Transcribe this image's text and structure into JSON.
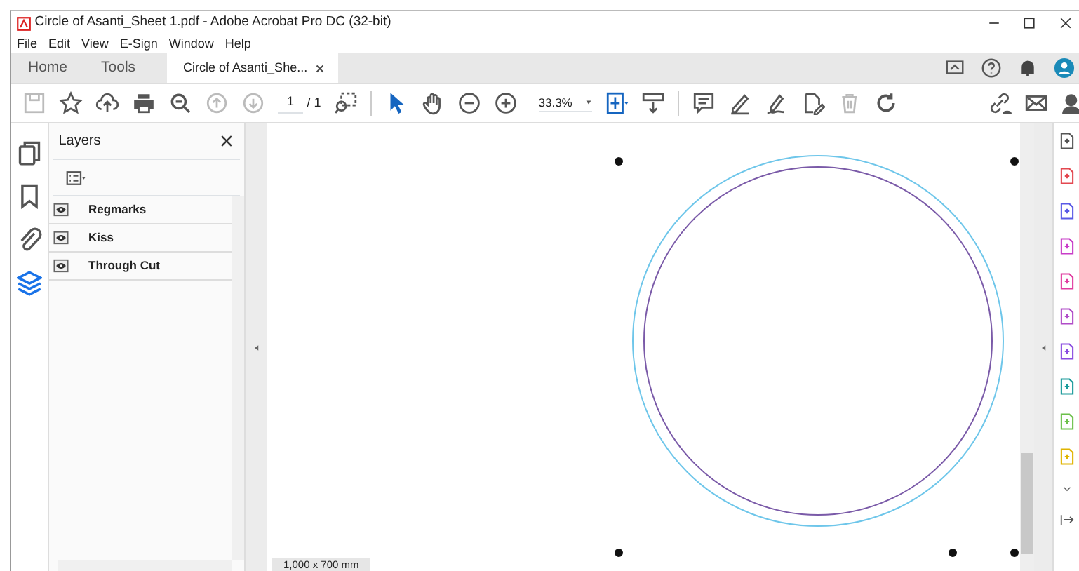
{
  "window": {
    "title": "Circle of Asanti_Sheet 1.pdf - Adobe Acrobat Pro DC (32-bit)"
  },
  "menu": [
    "File",
    "Edit",
    "View",
    "E-Sign",
    "Window",
    "Help"
  ],
  "tabs": [
    {
      "label": "Home",
      "selected": false
    },
    {
      "label": "Tools",
      "selected": false
    },
    {
      "label": "Circle of Asanti_She...",
      "selected": true,
      "closable": true
    }
  ],
  "toolbar": {
    "page_number": "1",
    "page_count": "/ 1",
    "zoom": "33.3%"
  },
  "nav_rail": [
    {
      "kind": "pages",
      "selected": false
    },
    {
      "kind": "bookmarks",
      "selected": false
    },
    {
      "kind": "attachments",
      "selected": false
    },
    {
      "kind": "layers",
      "selected": true
    }
  ],
  "layers_panel": {
    "title": "Layers",
    "layers": [
      {
        "name": "Regmarks",
        "visible": true
      },
      {
        "name": "Kiss",
        "visible": true
      },
      {
        "name": "Through Cut",
        "visible": true
      }
    ]
  },
  "status": {
    "page_size": "1,000 x 700 mm"
  }
}
